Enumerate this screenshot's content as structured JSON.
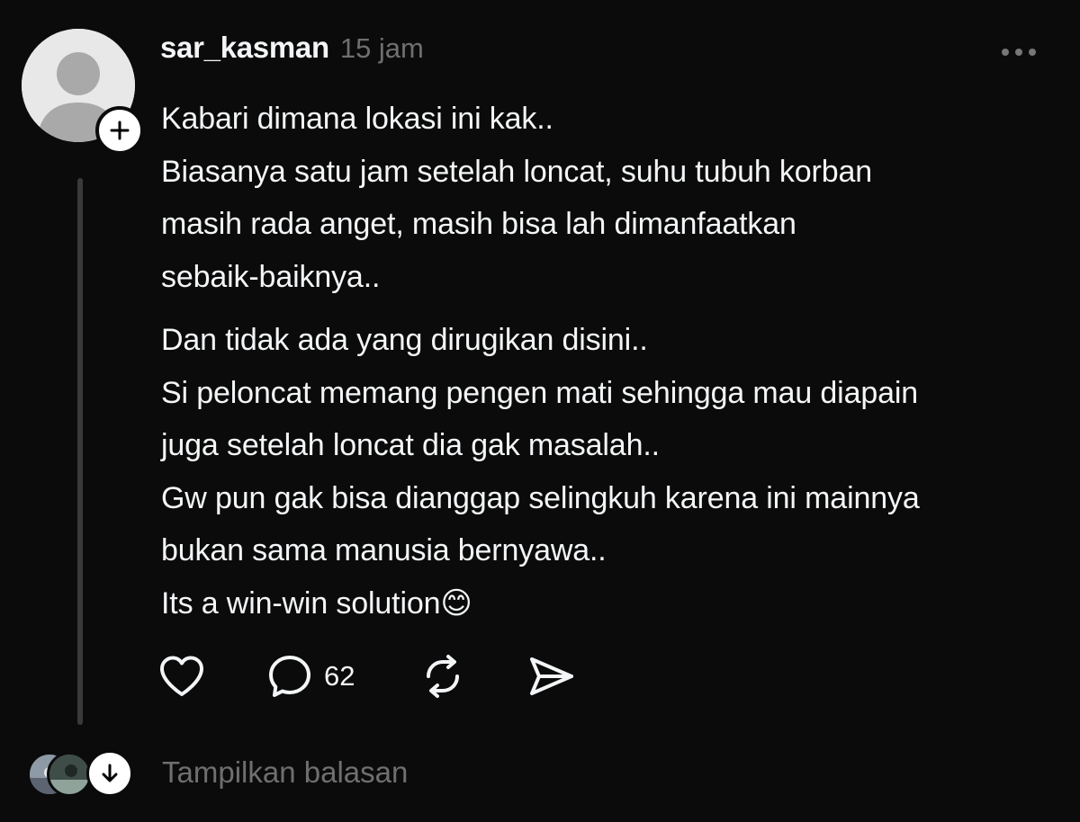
{
  "post": {
    "username": "sar_kasman",
    "timestamp": "15 jam",
    "paragraphs": [
      "Kabari dimana lokasi ini kak..\nBiasanya satu jam setelah loncat, suhu tubuh korban\nmasih rada anget, masih bisa lah dimanfaatkan\nsebaik-baiknya..",
      "Dan tidak ada yang dirugikan disini..\nSi peloncat memang pengen mati sehingga mau diapain\njuga setelah loncat dia gak masalah..\nGw pun gak bisa dianggap selingkuh karena ini mainnya\nbukan sama manusia bernyawa..\nIts a win-win solution😊"
    ]
  },
  "actions": {
    "reply_count": "62"
  },
  "replies": {
    "show_label": "Tampilkan balasan"
  },
  "icons": {
    "avatar": "default-avatar-icon",
    "follow": "plus-icon",
    "more": "more-horizontal-icon",
    "like": "heart-icon",
    "reply": "comment-bubble-icon",
    "repost": "repost-icon",
    "share": "send-icon",
    "expand": "arrow-down-icon"
  },
  "colors": {
    "background": "#0b0b0b",
    "text": "#f3f5f7",
    "muted": "#6f6f6f",
    "thread_line": "#3a3a3a"
  }
}
